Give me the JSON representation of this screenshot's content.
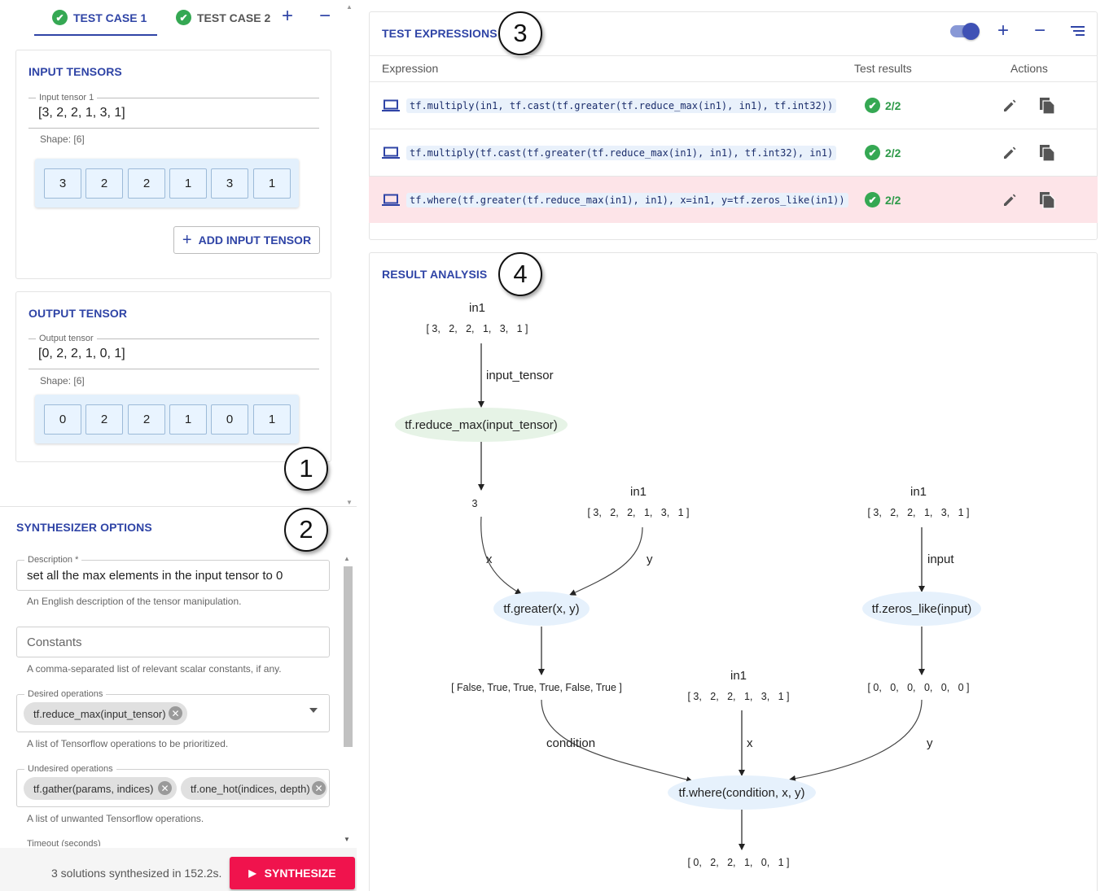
{
  "tabs": [
    {
      "label": "TEST CASE 1",
      "active": true
    },
    {
      "label": "TEST CASE 2",
      "active": false
    }
  ],
  "input_tensors": {
    "title": "INPUT TENSORS",
    "field_label": "Input tensor 1",
    "value": "[3, 2, 2, 1, 3, 1]",
    "shape": "Shape: [6]",
    "cells": [
      "3",
      "2",
      "2",
      "1",
      "3",
      "1"
    ],
    "add_button": "ADD INPUT TENSOR"
  },
  "output_tensor": {
    "title": "OUTPUT TENSOR",
    "field_label": "Output tensor",
    "value": "[0, 2, 2, 1, 0, 1]",
    "shape": "Shape: [6]",
    "cells": [
      "0",
      "2",
      "2",
      "1",
      "0",
      "1"
    ]
  },
  "synth": {
    "title": "SYNTHESIZER OPTIONS",
    "description_label": "Description *",
    "description_value": "set all the max elements in the input tensor to 0",
    "description_help": "An English description of the tensor manipulation.",
    "constants_placeholder": "Constants",
    "constants_help": "A comma-separated list of relevant scalar constants, if any.",
    "desired_label": "Desired operations",
    "desired_chips": [
      "tf.reduce_max(input_tensor)"
    ],
    "desired_help": "A list of Tensorflow operations to be prioritized.",
    "undesired_label": "Undesired operations",
    "undesired_chips": [
      "tf.gather(params, indices)",
      "tf.one_hot(indices, depth)"
    ],
    "undesired_help": "A list of unwanted Tensorflow operations.",
    "timeout_label": "Timeout (seconds)",
    "status": "3 solutions synthesized in 152.2s.",
    "synthesize_button": "SYNTHESIZE"
  },
  "callouts": [
    "1",
    "2",
    "3",
    "4"
  ],
  "expressions": {
    "title": "TEST EXPRESSIONS",
    "columns": [
      "Expression",
      "Test results",
      "Actions"
    ],
    "rows": [
      {
        "code": "tf.multiply(in1, tf.cast(tf.greater(tf.reduce_max(in1), in1), tf.int32))",
        "result": "2/2",
        "highlighted": false
      },
      {
        "code": "tf.multiply(tf.cast(tf.greater(tf.reduce_max(in1), in1), tf.int32), in1)",
        "result": "2/2",
        "highlighted": false
      },
      {
        "code": "tf.where(tf.greater(tf.reduce_max(in1), in1), x=in1, y=tf.zeros_like(in1))",
        "result": "2/2",
        "highlighted": true
      }
    ]
  },
  "analysis": {
    "title": "RESULT ANALYSIS",
    "in_label": "in1",
    "in_value": "[ 3,   2,   2,   1,   3,   1 ]",
    "edge_input_tensor": "input_tensor",
    "node_reduce_max": "tf.reduce_max(input_tensor)",
    "reduce_result": "3",
    "edge_x": "x",
    "edge_y": "y",
    "edge_input": "input",
    "node_greater": "tf.greater(x, y)",
    "node_zeros_like": "tf.zeros_like(input)",
    "greater_result": "[ False, True, True, True, False, True ]",
    "zeros_result": "[ 0,   0,   0,   0,   0,   0 ]",
    "edge_condition": "condition",
    "node_where": "tf.where(condition, x, y)",
    "final_result": "[ 0,   2,   2,   1,   0,   1 ]"
  },
  "colors": {
    "accent": "#2f44a6",
    "success": "#35a853",
    "synthesize": "#f0134d",
    "highlight_row": "#fde4e8",
    "node_green": "#e6f3e6",
    "node_blue": "#e6f1fc"
  }
}
